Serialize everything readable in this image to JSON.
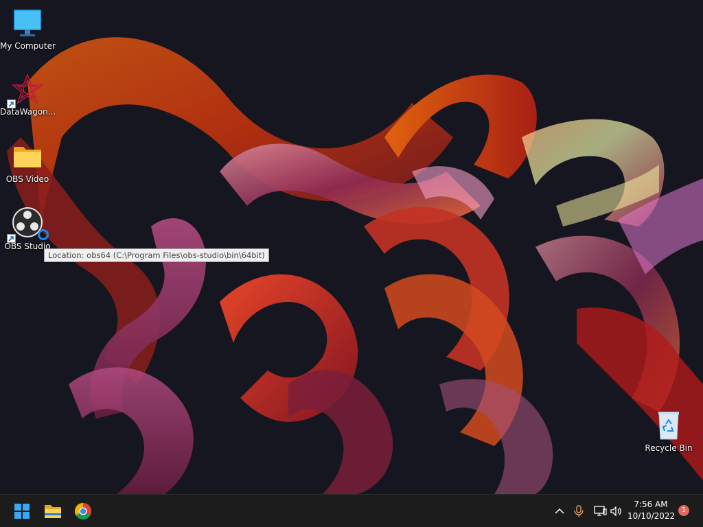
{
  "desktop": {
    "icons": [
      {
        "name": "my-computer",
        "label": "My Computer",
        "icon": "monitor-icon"
      },
      {
        "name": "datawagon",
        "label": "DataWagon...",
        "icon": "datawagon-icon",
        "shortcut": true
      },
      {
        "name": "obs-video",
        "label": "OBS Video",
        "icon": "folder-icon"
      },
      {
        "name": "obs-studio",
        "label": "OBS Studio",
        "icon": "obs-icon",
        "shortcut": true
      },
      {
        "name": "recycle-bin",
        "label": "Recycle Bin",
        "icon": "recycle-bin-icon"
      }
    ],
    "tooltip": "Location: obs64 (C:\\Program Files\\obs-studio\\bin\\64bit)"
  },
  "taskbar": {
    "pinned": [
      "windows-start-icon",
      "file-explorer-icon",
      "chrome-icon"
    ],
    "tray": [
      "chevron-up-icon",
      "microphone-icon",
      "network-icon",
      "speaker-icon"
    ],
    "time": "7:56 AM",
    "date": "10/10/2022",
    "notifications": "1"
  },
  "colors": {
    "taskbar": "#1c1c1c",
    "wallpaper_bg": "#15161f",
    "accent": "#0078d4"
  }
}
